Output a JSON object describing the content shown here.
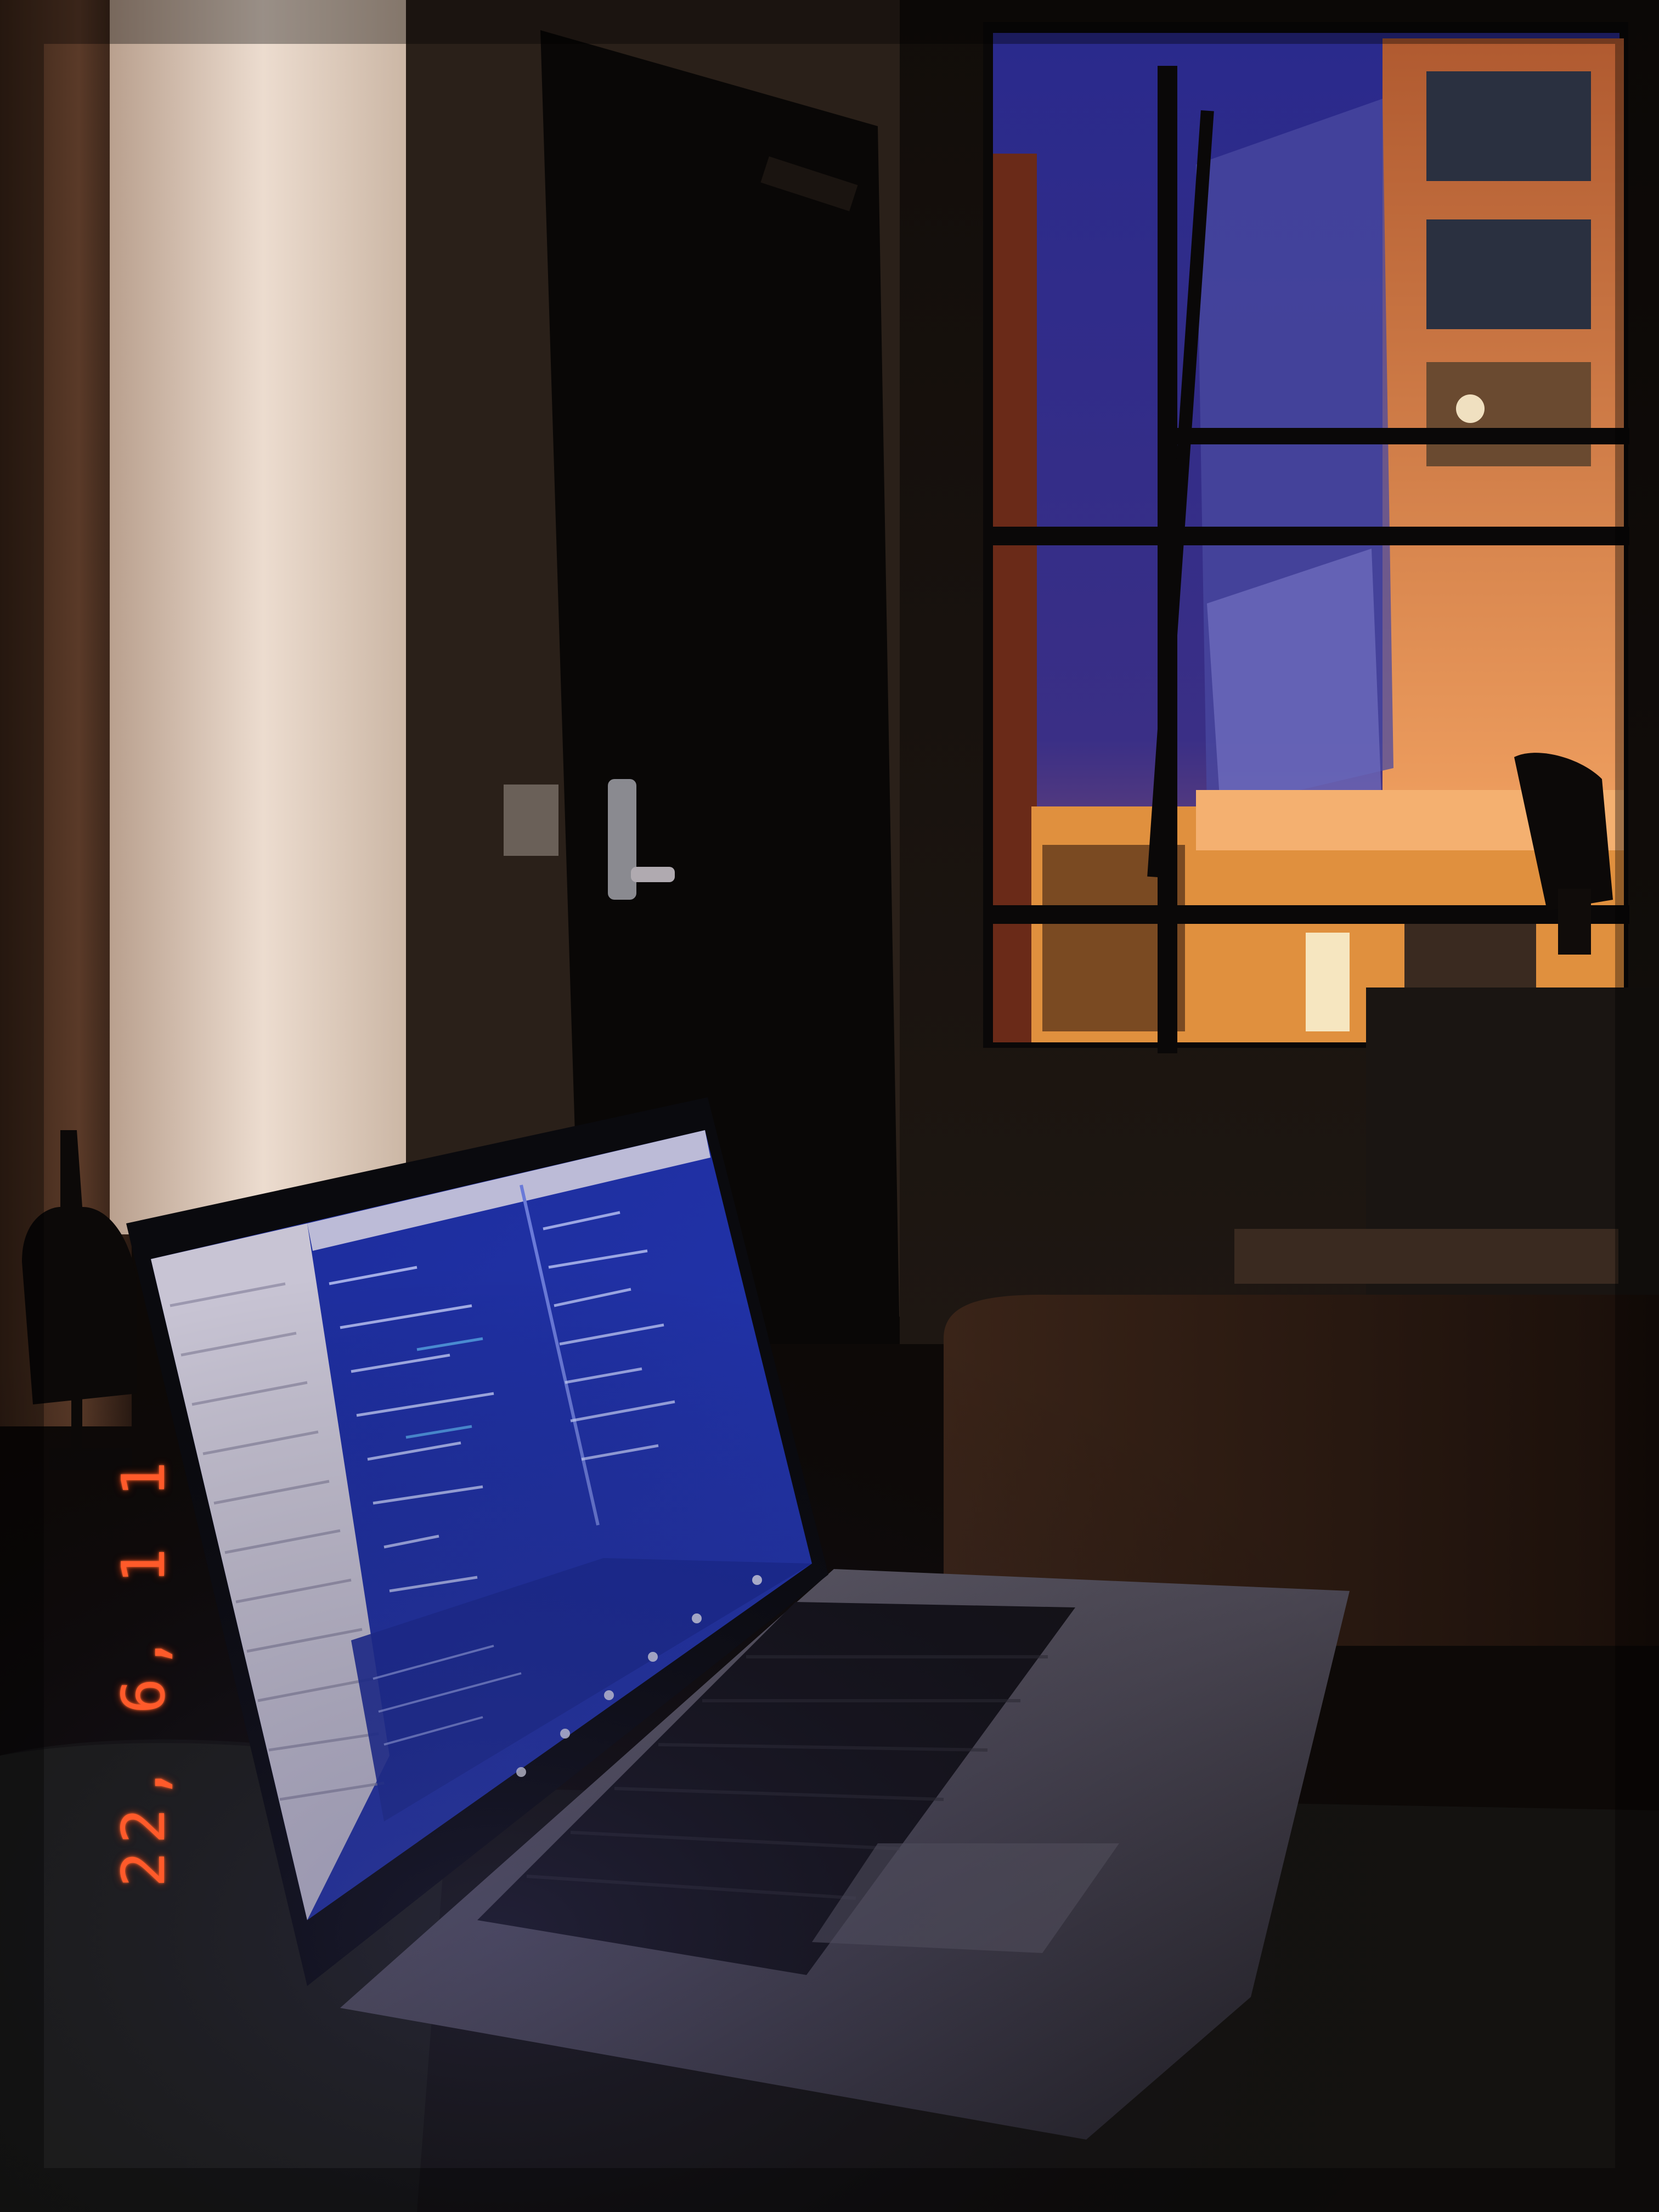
{
  "photo": {
    "subject": "laptop-on-couch-with-window",
    "date_stamp": "22, 6, 1 1",
    "colors": {
      "night_sky": "#2e2a86",
      "screen_code": "#1a2a8a",
      "warm_light": "#e07a2a",
      "stamp": "#ff5a2a"
    }
  }
}
